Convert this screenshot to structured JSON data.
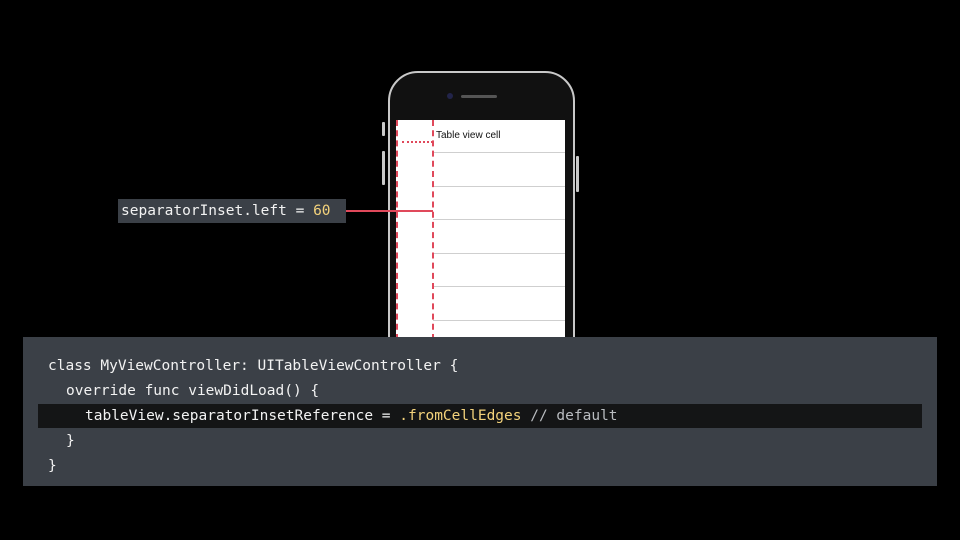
{
  "phone": {
    "cell_label": "Table view cell"
  },
  "callout": {
    "property": "separatorInset.left = ",
    "value": "60"
  },
  "code": {
    "line1": "class MyViewController: UITableViewController {",
    "line2": "override func viewDidLoad() {",
    "line3_prefix": "tableView.separatorInsetReference = ",
    "line3_enum": ".fromCellEdges",
    "line3_comment": " // default",
    "line4": "}",
    "line5": "}"
  },
  "colors": {
    "background": "#000000",
    "panel": "#3b4047",
    "highlight_row": "#141516",
    "accent_red": "#e0495b",
    "number_yellow": "#f3d27b"
  }
}
